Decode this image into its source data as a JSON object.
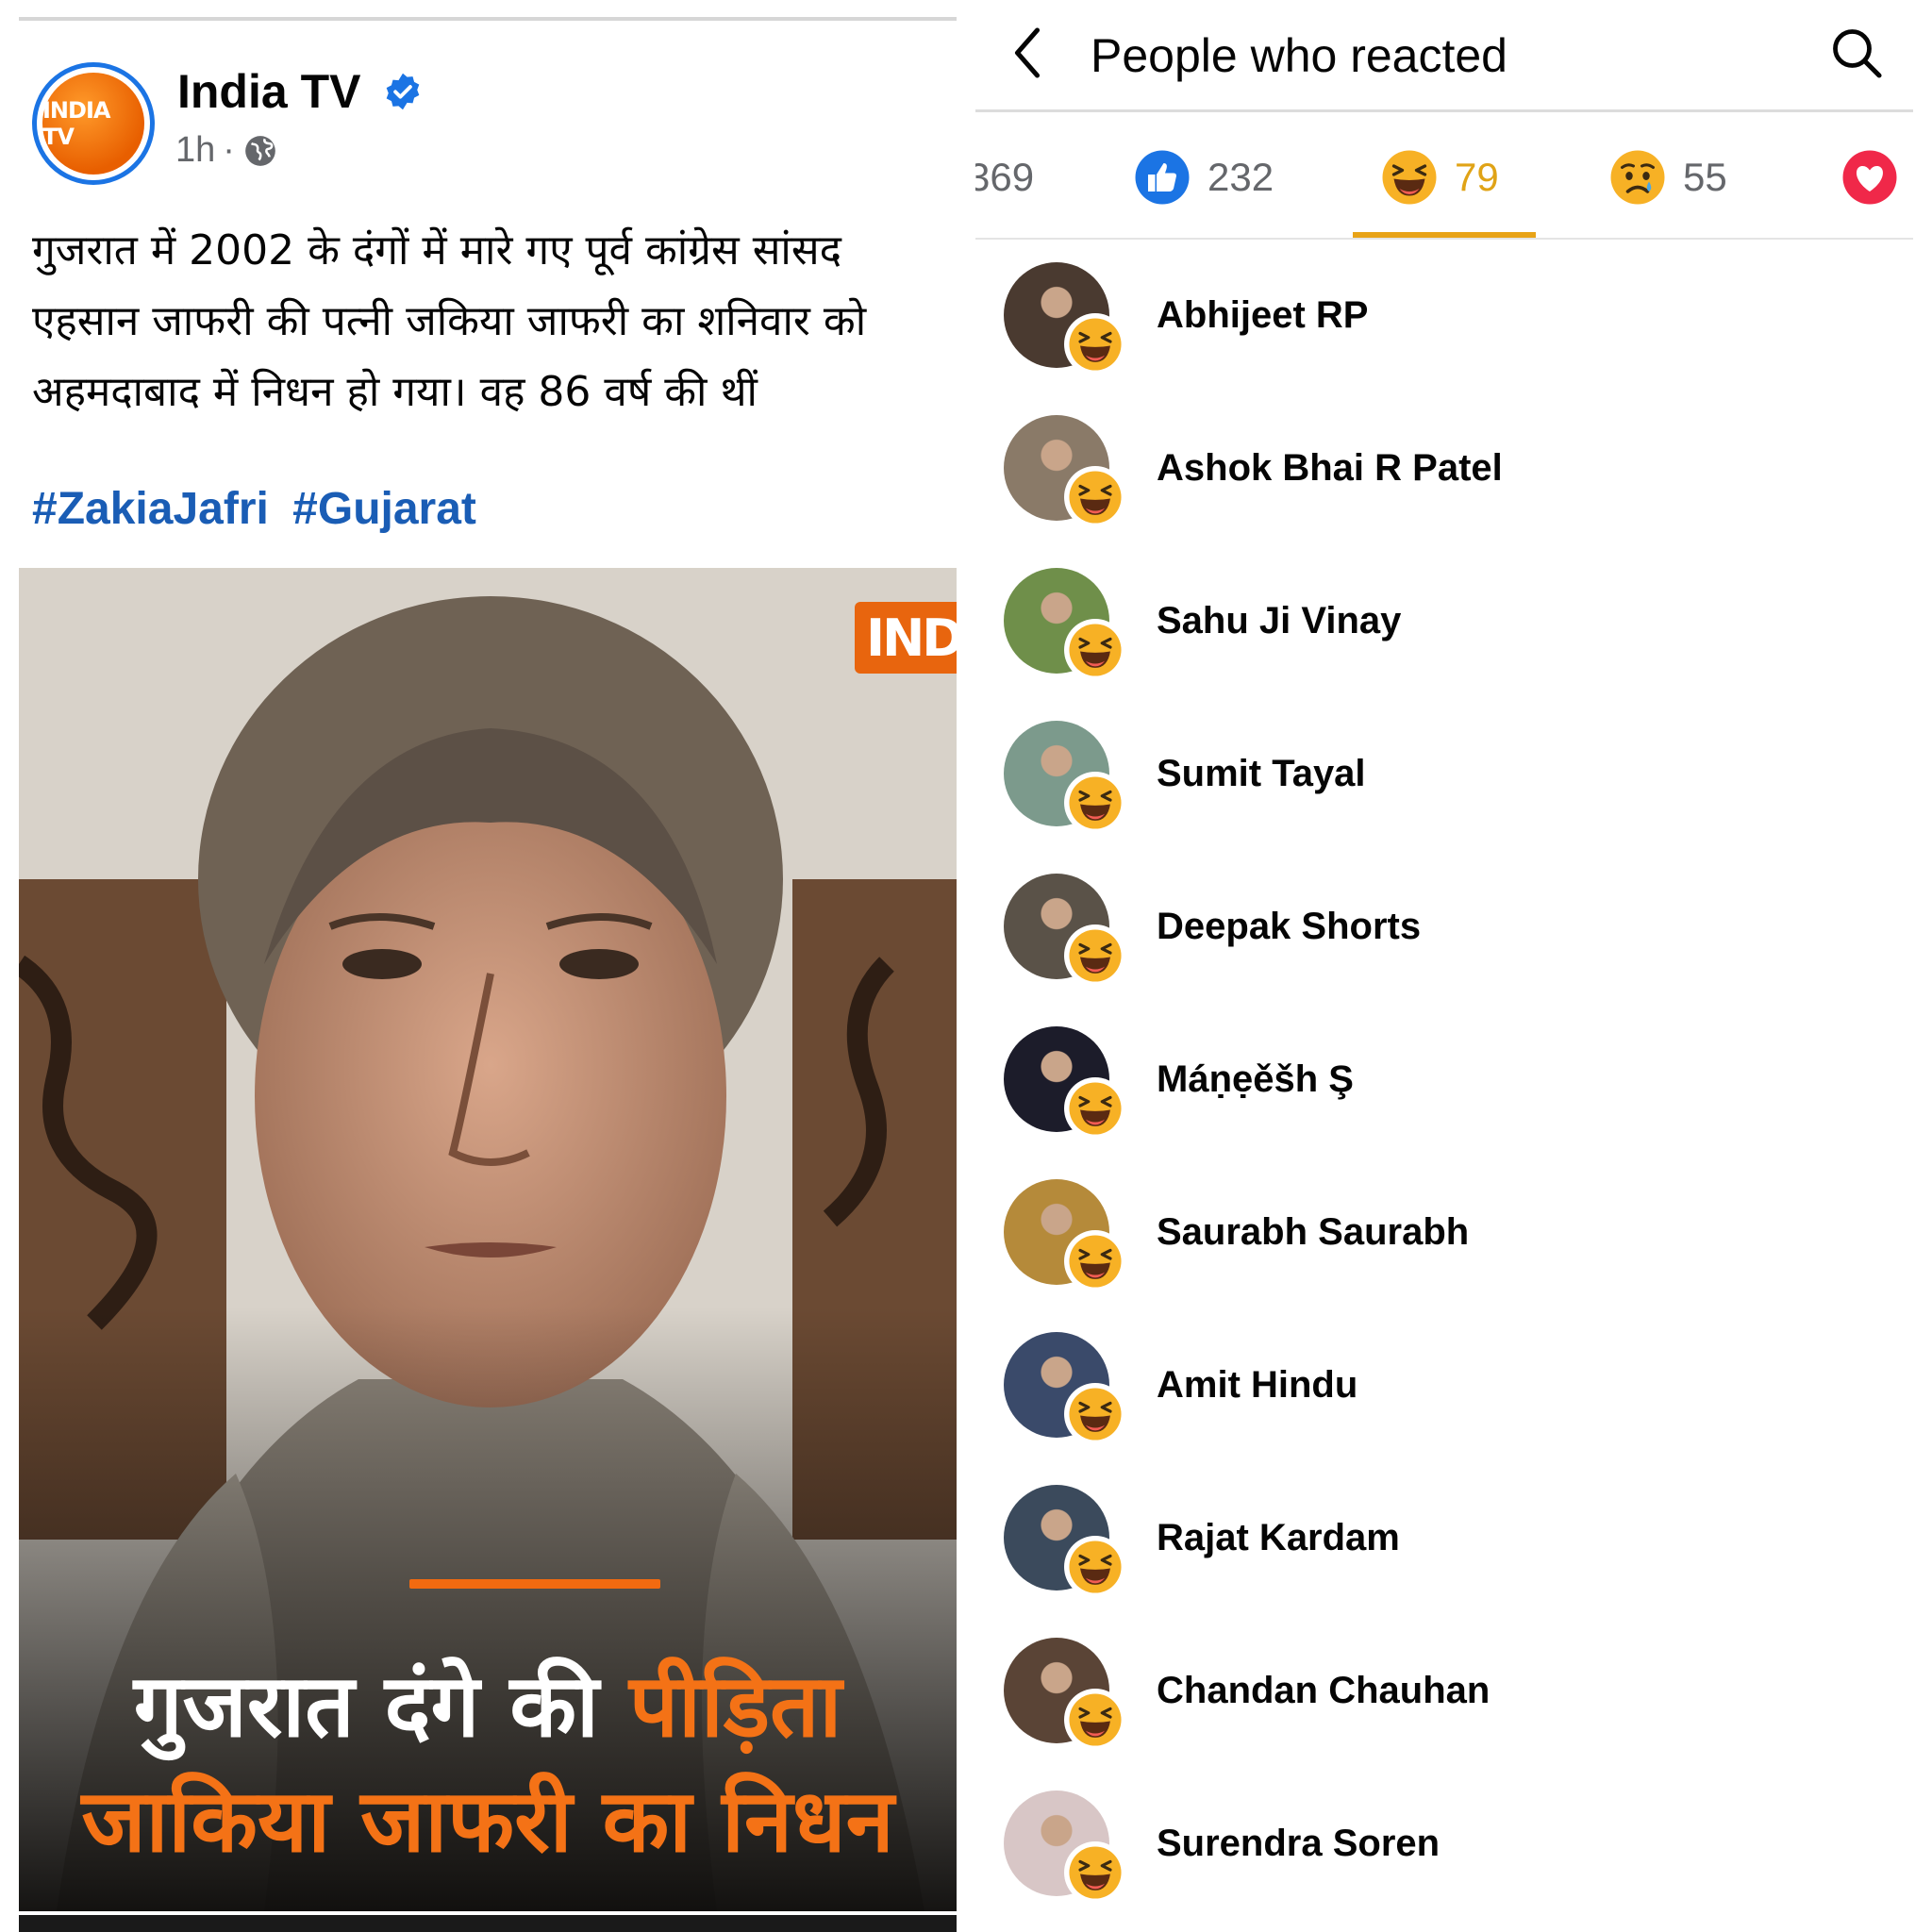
{
  "post": {
    "page_name": "India TV",
    "avatar_text": "INDIA TV",
    "time": "1h",
    "separator": "·",
    "body_lines": [
      "गुजरात में 2002 के दंगों में मारे गए पूर्व कांग्रेस सांसद",
      "एहसान जाफरी की पत्नी जकिया जाफरी का शनिवार को",
      "अहमदाबाद में निधन हो गया। वह 86 वर्ष की थीं"
    ],
    "hashtags": [
      "#ZakiaJafri",
      "#Gujarat"
    ],
    "media": {
      "logo_text": "IND",
      "headline_line1_white": "गुजरात दंगे की",
      "headline_line1_orange": "पीड़िता",
      "headline_line2": "जाकिया जाफरी का निधन"
    }
  },
  "reactions": {
    "title": "People who reacted",
    "tabs": [
      {
        "icon": "all-count",
        "count": "369"
      },
      {
        "icon": "like-icon",
        "count": "232"
      },
      {
        "icon": "haha-icon",
        "count": "79",
        "active": true
      },
      {
        "icon": "sad-icon",
        "count": "55"
      },
      {
        "icon": "love-icon",
        "count": ""
      }
    ],
    "people": [
      {
        "name": "Abhijeet RP",
        "avatar_color": "#4a3a30"
      },
      {
        "name": "Ashok Bhai R Patel",
        "avatar_color": "#8a7a68"
      },
      {
        "name": "Sahu Ji Vinay",
        "avatar_color": "#6f8f4a"
      },
      {
        "name": "Sumit Tayal",
        "avatar_color": "#7c9a8c"
      },
      {
        "name": "Deepak Shorts",
        "avatar_color": "#5a5248"
      },
      {
        "name": "Máṇẹěšh Ş",
        "avatar_color": "#1c1c2a"
      },
      {
        "name": "Saurabh Saurabh",
        "avatar_color": "#b58a3a"
      },
      {
        "name": "Amit Hindu",
        "avatar_color": "#3a4a6a"
      },
      {
        "name": "Rajat Kardam",
        "avatar_color": "#3b4a5c"
      },
      {
        "name": "Chandan Chauhan",
        "avatar_color": "#5a4436"
      },
      {
        "name": "Surendra Soren",
        "avatar_color": "#d8c6c6"
      }
    ]
  }
}
